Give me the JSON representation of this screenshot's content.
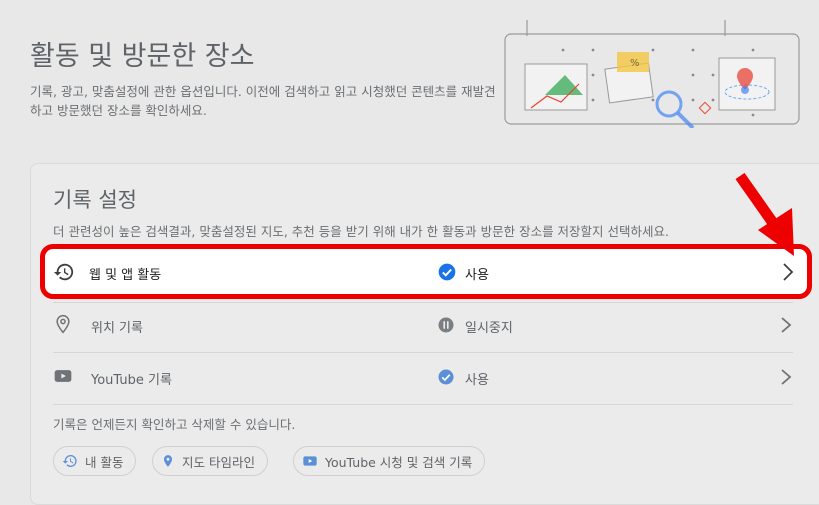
{
  "header": {
    "title": "활동 및 방문한 장소",
    "description": "기록, 광고, 맞춤설정에 관한 옵션입니다. 이전에 검색하고 읽고 시청했던 콘텐츠를 재발견하고 방문했던 장소를 확인하세요."
  },
  "history_settings": {
    "title": "기록 설정",
    "description": "더 관련성이 높은 검색결과, 맞춤설정된 지도, 추천 등을 받기 위해 내가 한 활동과 방문한 장소를 저장할지 선택하세요.",
    "rows": [
      {
        "label": "웹 및 앱 활동",
        "status": "사용",
        "icon": "history-icon",
        "status_icon": "check-circle-icon"
      },
      {
        "label": "위치 기록",
        "status": "일시중지",
        "icon": "location-pin-icon",
        "status_icon": "pause-circle-icon"
      },
      {
        "label": "YouTube 기록",
        "status": "사용",
        "icon": "youtube-icon",
        "status_icon": "check-circle-icon"
      }
    ],
    "note": "기록은 언제든지 확인하고 삭제할 수 있습니다.",
    "chips": [
      {
        "label": "내 활동",
        "icon": "history-icon"
      },
      {
        "label": "지도 타임라인",
        "icon": "location-pin-icon"
      },
      {
        "label": "YouTube 시청 및 검색 기록",
        "icon": "youtube-icon"
      }
    ]
  },
  "colors": {
    "highlight_border": "#ef0000",
    "check_blue": "#1a73e8",
    "arrow_red": "#ef0000"
  }
}
